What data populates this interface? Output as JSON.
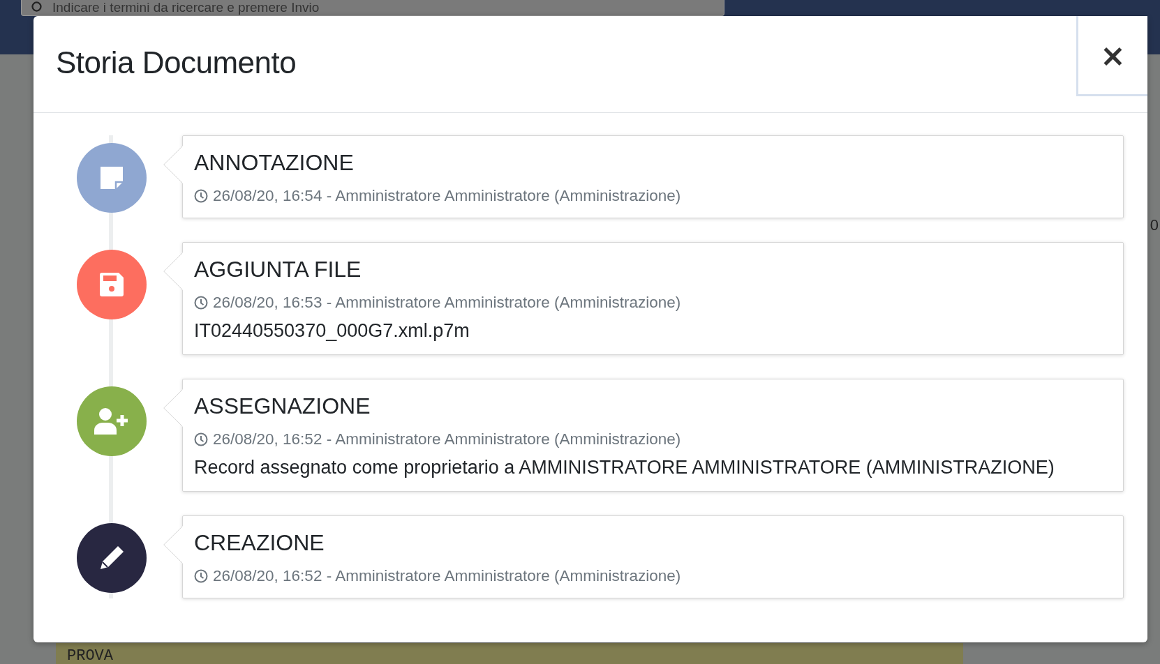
{
  "background": {
    "search": {
      "placeholder": "Indicare i termini da ricercare e premere Invio"
    },
    "note_label": "PROVA",
    "side_fragment": "0"
  },
  "modal": {
    "title": "Storia Documento",
    "close_label": "×",
    "events": [
      {
        "kind": "annotation",
        "color": "#8fa7d1",
        "title": "ANNOTAZIONE",
        "meta": "26/08/20, 16:54 - Amministratore Amministratore (Amministrazione)"
      },
      {
        "kind": "file",
        "color": "#fd6e5f",
        "title": "AGGIUNTA FILE",
        "meta": "26/08/20, 16:53 - Amministratore Amministratore (Amministrazione)",
        "detail": "IT02440550370_000G7.xml.p7m"
      },
      {
        "kind": "assign",
        "color": "#88b04b",
        "title": "ASSEGNAZIONE",
        "meta": "26/08/20, 16:52 - Amministratore Amministratore (Amministrazione)",
        "detail": "Record assegnato come proprietario a AMMINISTRATORE AMMINISTRATORE (AMMINISTRAZIONE)"
      },
      {
        "kind": "create",
        "color": "#282741",
        "title": "CREAZIONE",
        "meta": "26/08/20, 16:52 - Amministratore Amministratore (Amministrazione)"
      }
    ]
  }
}
